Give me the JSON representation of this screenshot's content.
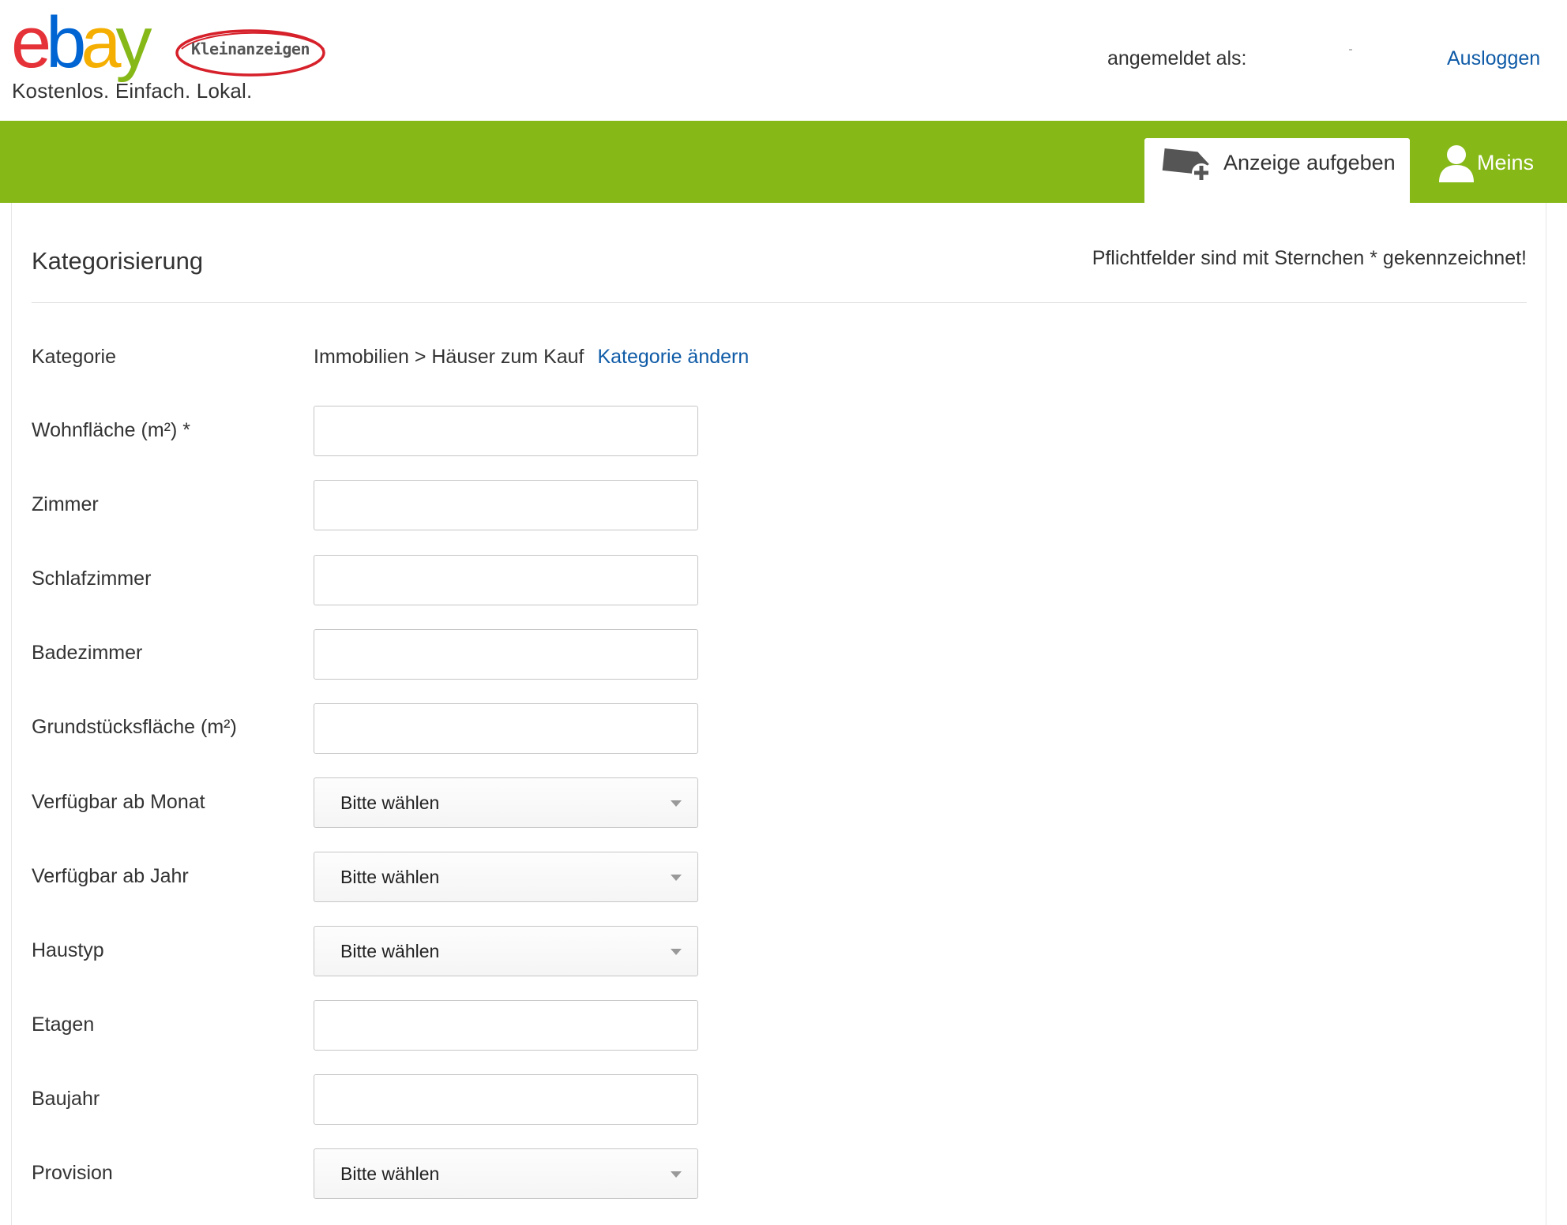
{
  "header": {
    "logo_alt": "ebay Kleinanzeigen",
    "logo_badge": "Kleinanzeigen",
    "tagline": "Kostenlos. Einfach. Lokal.",
    "logged_in_label": "angemeldet als:",
    "logout_label": "Ausloggen"
  },
  "nav": {
    "post_ad_label": "Anzeige aufgeben",
    "meins_label": "Meins"
  },
  "form": {
    "section_title": "Kategorisierung",
    "mandatory_note": "Pflichtfelder sind mit Sternchen * gekennzeichnet!",
    "category": {
      "label": "Kategorie",
      "path": "Immobilien > Häuser zum Kauf",
      "change_link": "Kategorie ändern"
    },
    "fields": [
      {
        "label": "Wohnfläche (m²) *",
        "type": "text",
        "value": ""
      },
      {
        "label": "Zimmer",
        "type": "text",
        "value": ""
      },
      {
        "label": "Schlafzimmer",
        "type": "text",
        "value": ""
      },
      {
        "label": "Badezimmer",
        "type": "text",
        "value": ""
      },
      {
        "label": "Grundstücksfläche (m²)",
        "type": "text",
        "value": ""
      },
      {
        "label": "Verfügbar ab Monat",
        "type": "select",
        "value": "Bitte wählen"
      },
      {
        "label": "Verfügbar ab Jahr",
        "type": "select",
        "value": "Bitte wählen"
      },
      {
        "label": "Haustyp",
        "type": "select",
        "value": "Bitte wählen"
      },
      {
        "label": "Etagen",
        "type": "text",
        "value": ""
      },
      {
        "label": "Baujahr",
        "type": "text",
        "value": ""
      },
      {
        "label": "Provision",
        "type": "select",
        "value": "Bitte wählen"
      }
    ]
  },
  "colors": {
    "nav_green": "#86b817",
    "link_blue": "#0f5ba7",
    "ebay_e": "#e53238",
    "ebay_b": "#0064d2",
    "ebay_a": "#f5af02",
    "ebay_y": "#86b817"
  }
}
